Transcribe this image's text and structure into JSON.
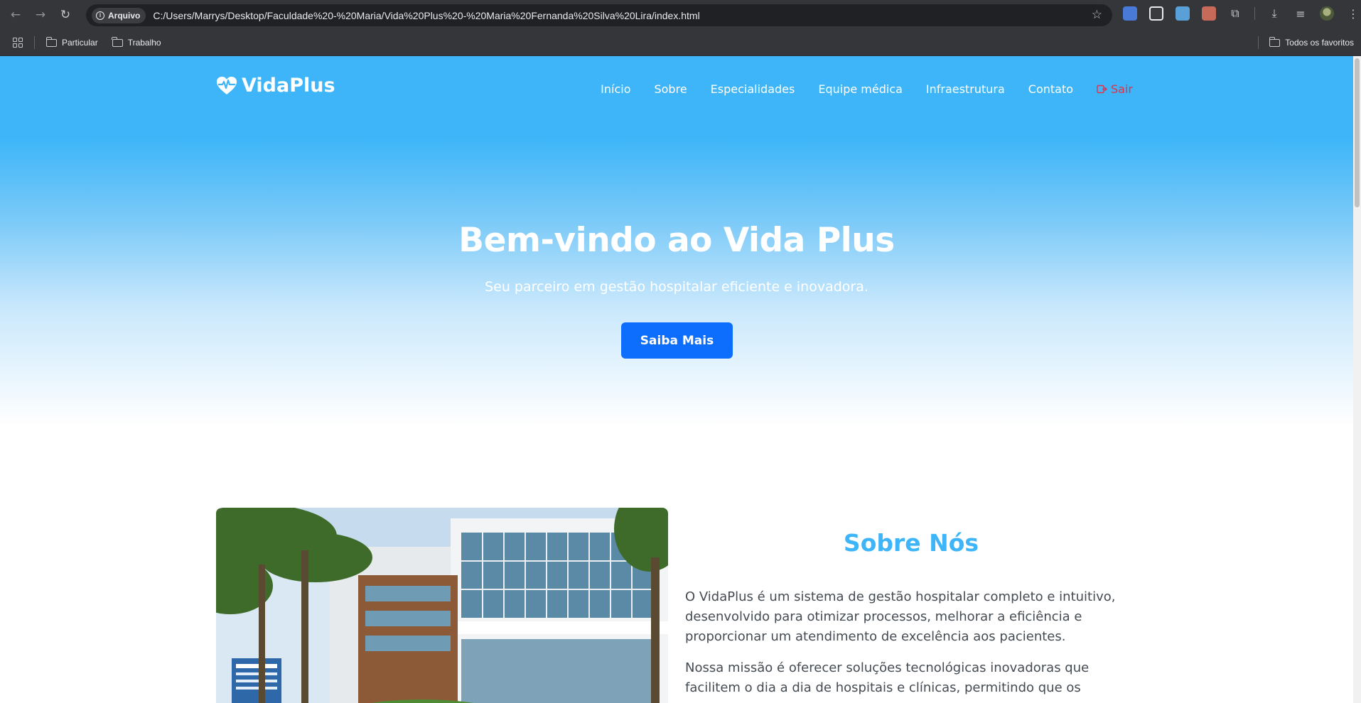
{
  "browser": {
    "site_chip": "Arquivo",
    "url": "C:/Users/Marrys/Desktop/Faculdade%20-%20Maria/Vida%20Plus%20-%20Maria%20Fernanda%20Silva%20Lira/index.html",
    "bookmarks": [
      "Particular",
      "Trabalho"
    ],
    "all_bookmarks": "Todos os favoritos"
  },
  "navbar": {
    "logo": "VidaPlus",
    "links": [
      "Início",
      "Sobre",
      "Especialidades",
      "Equipe médica",
      "Infraestrutura",
      "Contato"
    ],
    "exit": "Sair"
  },
  "hero": {
    "title": "Bem-vindo ao Vida Plus",
    "subtitle": "Seu parceiro em gestão hospitalar eficiente e inovadora.",
    "cta": "Saiba Mais"
  },
  "about": {
    "title": "Sobre Nós",
    "paragraphs": [
      "O VidaPlus é um sistema de gestão hospitalar completo e intuitivo, desenvolvido para otimizar processos, melhorar a eficiência e proporcionar um atendimento de excelência aos pacientes.",
      "Nossa missão é oferecer soluções tecnológicas inovadoras que facilitem o dia a dia de hospitais e clínicas, permitindo que os"
    ]
  },
  "colors": {
    "primary": "#3db5f8",
    "button": "#0d6efd",
    "exit": "#e43148"
  }
}
